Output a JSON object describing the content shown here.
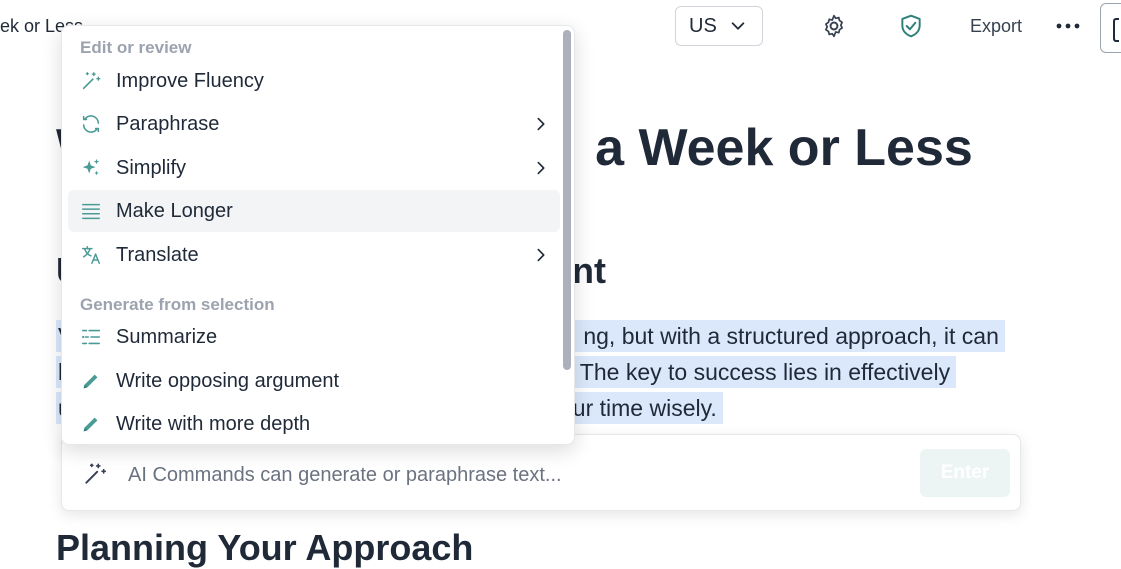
{
  "header": {
    "doc_title": "ek or Less",
    "language": "US",
    "export_label": "Export"
  },
  "document": {
    "heading_partial": "a Week or Less",
    "heading_left_fragment": "W",
    "subheading_partial": "nt",
    "subheading_left_fragment": "U",
    "paragraph_lines": [
      {
        "left": "V",
        "right": "ng, but with a structured approach, it can"
      },
      {
        "left": "b",
        "right": "The key to success lies in effectively"
      },
      {
        "left": "u",
        "right": "ur time wisely."
      }
    ],
    "next_heading": "Planning Your Approach"
  },
  "ai_bar": {
    "placeholder": "AI Commands can generate or paraphrase text...",
    "enter_label": "Enter"
  },
  "menu": {
    "section_edit": "Edit or review",
    "section_generate": "Generate from selection",
    "items": [
      {
        "label": "Improve Fluency",
        "icon": "wand-icon"
      },
      {
        "label": "Paraphrase",
        "icon": "refresh-icon",
        "submenu": true
      },
      {
        "label": "Simplify",
        "icon": "sparkles-icon",
        "submenu": true
      },
      {
        "label": "Make Longer",
        "icon": "lines-icon",
        "highlighted": true
      },
      {
        "label": "Translate",
        "icon": "translate-icon",
        "submenu": true
      },
      {
        "label": "Summarize",
        "icon": "list-icon"
      },
      {
        "label": "Write opposing argument",
        "icon": "pencil-icon"
      },
      {
        "label": "Write with more depth",
        "icon": "pencil-icon"
      }
    ]
  },
  "colors": {
    "accent": "#4a9a96",
    "highlight": "#dbe8fc",
    "text": "#1f2937",
    "muted": "#9ca3af"
  }
}
